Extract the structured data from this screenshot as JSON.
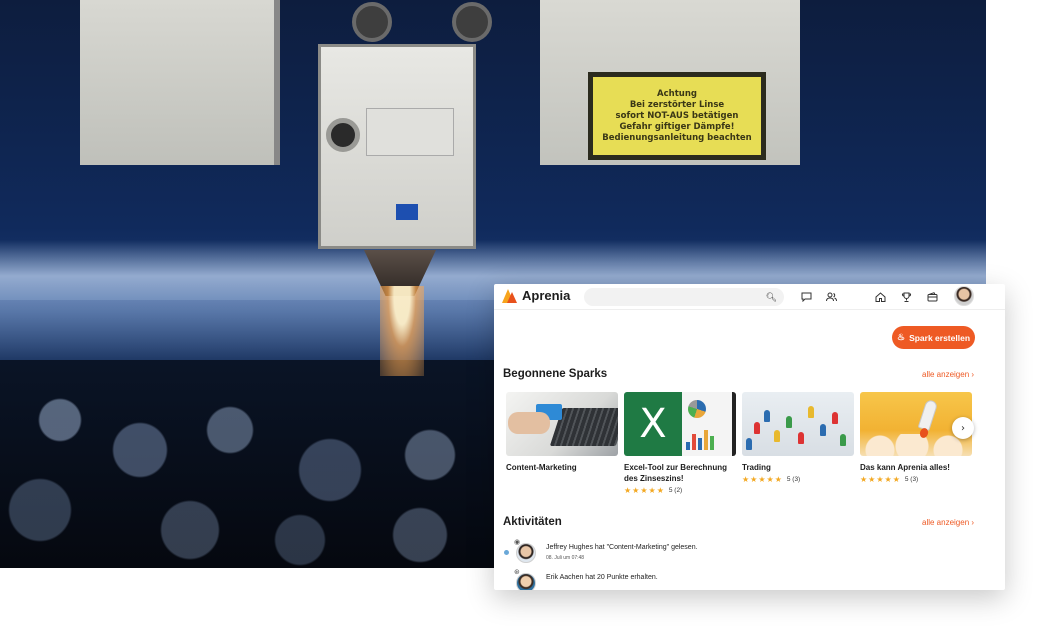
{
  "background_photo": {
    "warning_sign": [
      "Achtung",
      "Bei zerstörter Linse",
      "sofort NOT-AUS betätigen",
      "Gefahr giftiger Dämpfe!",
      "Bedienungsanleitung beachten"
    ]
  },
  "header": {
    "brand": "Aprenia",
    "search": {
      "placeholder": "",
      "value": ""
    },
    "icons": [
      "search-icon",
      "chat-icon",
      "users-icon",
      "home-icon",
      "trophy-icon",
      "wallet-icon",
      "avatar"
    ]
  },
  "actions": {
    "create_spark": "Spark erstellen"
  },
  "sections": {
    "started_sparks": {
      "title": "Begonnene Sparks",
      "see_all": "alle anzeigen ›",
      "cards": [
        {
          "title": "Content-Marketing",
          "stars": "",
          "rating": ""
        },
        {
          "title": "Excel-Tool zur Berechnung des Zinseszins!",
          "stars": "★★★★★",
          "rating": "5 (2)"
        },
        {
          "title": "Trading",
          "stars": "★★★★★",
          "rating": "5 (3)"
        },
        {
          "title": "Das kann Aprenia alles!",
          "stars": "★★★★★",
          "rating": "5 (3)"
        }
      ]
    },
    "activities": {
      "title": "Aktivitäten",
      "see_all": "alle anzeigen ›",
      "items": [
        {
          "text": "Jeffrey Hughes hat \"Content-Marketing\" gelesen.",
          "time": "08. Juli um 07:48"
        },
        {
          "text": "Erik Aachen hat 20 Punkte erhalten.",
          "time": ""
        }
      ]
    }
  },
  "colors": {
    "accent": "#ee5a24",
    "star": "#f3a821",
    "logo_yellow": "#f7a41d",
    "logo_orange": "#e8511c"
  }
}
